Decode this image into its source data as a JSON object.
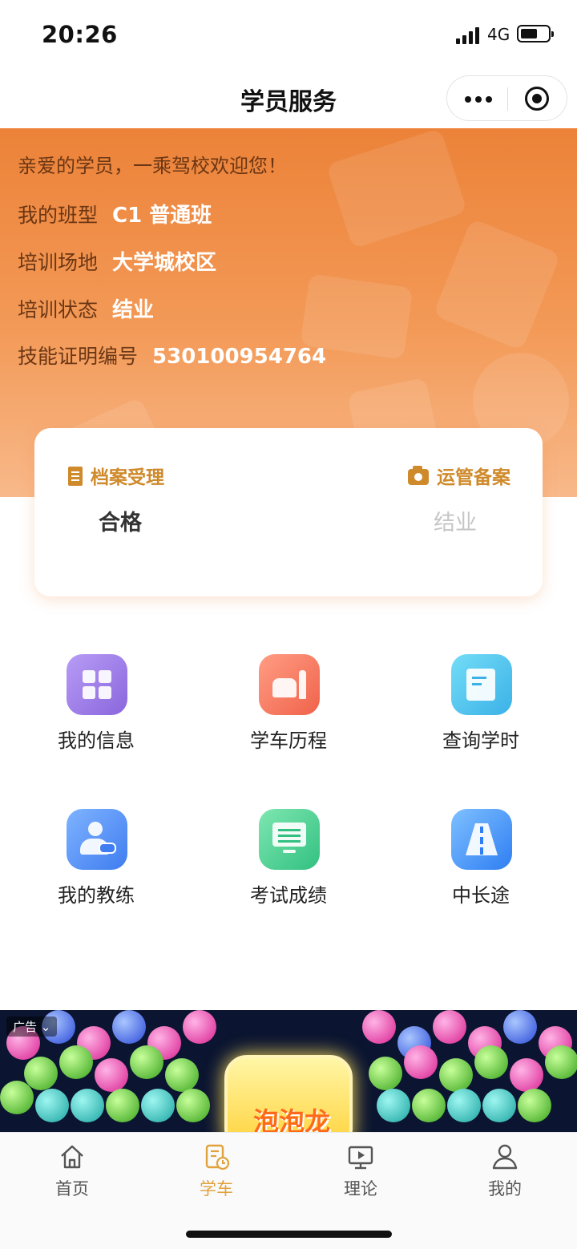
{
  "status_bar": {
    "time": "20:26",
    "network": "4G"
  },
  "nav": {
    "title": "学员服务"
  },
  "profile": {
    "welcome": "亲爱的学员，一乘驾校欢迎您！",
    "class_label": "我的班型",
    "class_value": "C1 普通班",
    "site_label": "培训场地",
    "site_value": "大学城校区",
    "status_label": "培训状态",
    "status_value": "结业",
    "cert_label": "技能证明编号",
    "cert_value": "530100954764"
  },
  "status_card": {
    "archive_label": "档案受理",
    "archive_value": "合格",
    "transport_label": "运管备案",
    "transport_value": "结业"
  },
  "grid": [
    {
      "label": "我的信息",
      "icon": "info-grid-icon"
    },
    {
      "label": "学车历程",
      "icon": "car-progress-icon"
    },
    {
      "label": "查询学时",
      "icon": "edit-hours-icon"
    },
    {
      "label": "我的教练",
      "icon": "coach-icon"
    },
    {
      "label": "考试成绩",
      "icon": "monitor-score-icon"
    },
    {
      "label": "中长途",
      "icon": "road-icon"
    }
  ],
  "ad": {
    "tag": "广告",
    "title": "泡泡龙"
  },
  "tabs": [
    {
      "label": "首页",
      "icon": "home-icon"
    },
    {
      "label": "学车",
      "icon": "study-car-icon",
      "active": true
    },
    {
      "label": "理论",
      "icon": "video-icon"
    },
    {
      "label": "我的",
      "icon": "user-icon"
    }
  ],
  "colors": {
    "accent": "#e0a23c",
    "hero": "#ec8238",
    "card_label": "#cf8a2b"
  }
}
